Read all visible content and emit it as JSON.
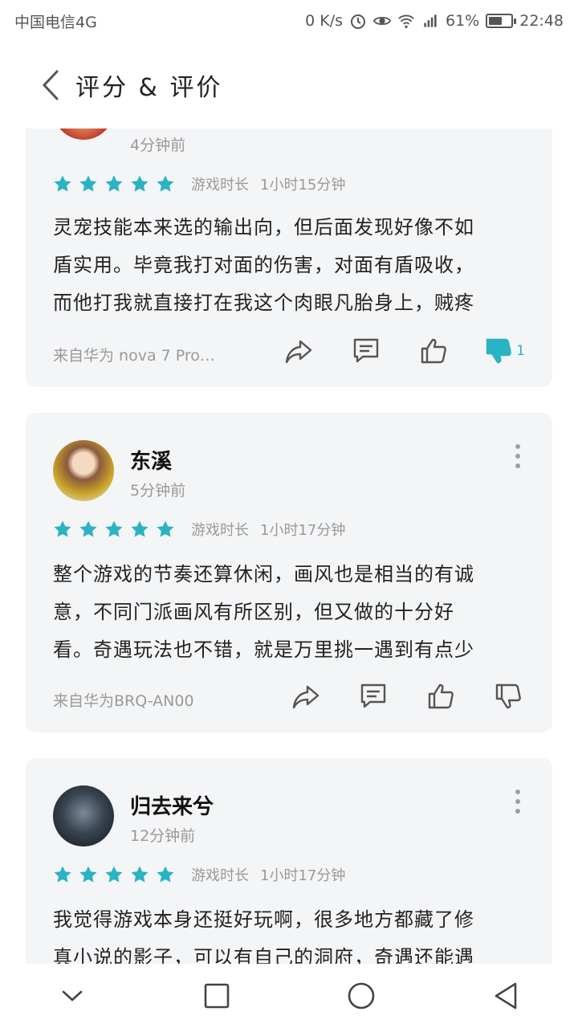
{
  "status_bar": {
    "carrier": "中国电信4G",
    "net_speed": "0 K/s",
    "battery": "61%",
    "battery_level": 0.61,
    "time": "22:48"
  },
  "header": {
    "title": "评分 & 评价"
  },
  "colors": {
    "accent": "#2ab3c3",
    "card_bg": "#f4f5f7"
  },
  "reviews": [
    {
      "time": "4分钟前",
      "rating": 5,
      "playtime_label": "游戏时长",
      "playtime": "1小时15分钟",
      "text_lines": [
        "灵宠技能本来选的输出向，但后面发现好像不如",
        "盾实用。毕竟我打对面的伤害，对面有盾吸收，",
        "而他打我就直接打在我这个肉眼凡胎身上，贼疼"
      ],
      "device": "来自华为 nova 7 Pro…",
      "dislike_count": "1"
    },
    {
      "username": "东溪",
      "time": "5分钟前",
      "rating": 5,
      "playtime_label": "游戏时长",
      "playtime": "1小时17分钟",
      "text_lines": [
        "整个游戏的节奏还算休闲，画风也是相当的有诚",
        "意，不同门派画风有所区别，但又做的十分好",
        "看。奇遇玩法也不错，就是万里挑一遇到有点少"
      ],
      "device": "来自华为BRQ-AN00"
    },
    {
      "username": "归去来兮",
      "time": "12分钟前",
      "rating": 5,
      "playtime_label": "游戏时长",
      "playtime": "1小时17分钟",
      "text_lines": [
        "我觉得游戏本身还挺好玩啊，很多地方都藏了修",
        "真小说的影子，可以有自己的洞府，奇遇还能遇"
      ]
    }
  ]
}
